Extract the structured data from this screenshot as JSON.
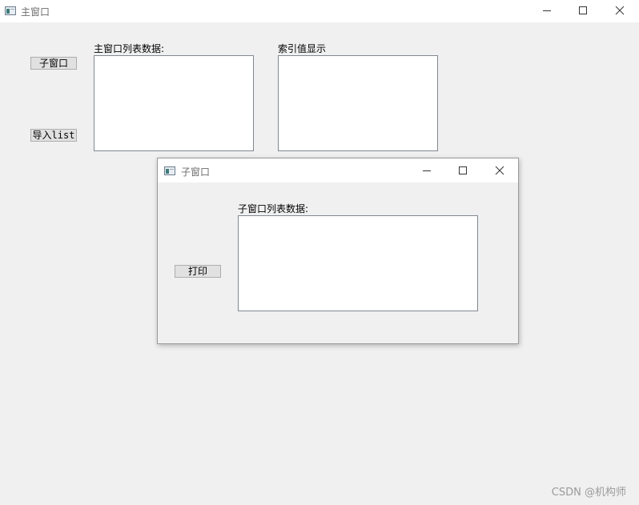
{
  "main_window": {
    "title": "主窗口",
    "child_window_button": "子窗口",
    "import_list_button": "导入list",
    "list_label": "主窗口列表数据:",
    "index_label": "索引值显示"
  },
  "child_window": {
    "title": "子窗口",
    "print_button": "打印",
    "list_label": "子窗口列表数据:"
  },
  "watermark": "CSDN @机构师"
}
